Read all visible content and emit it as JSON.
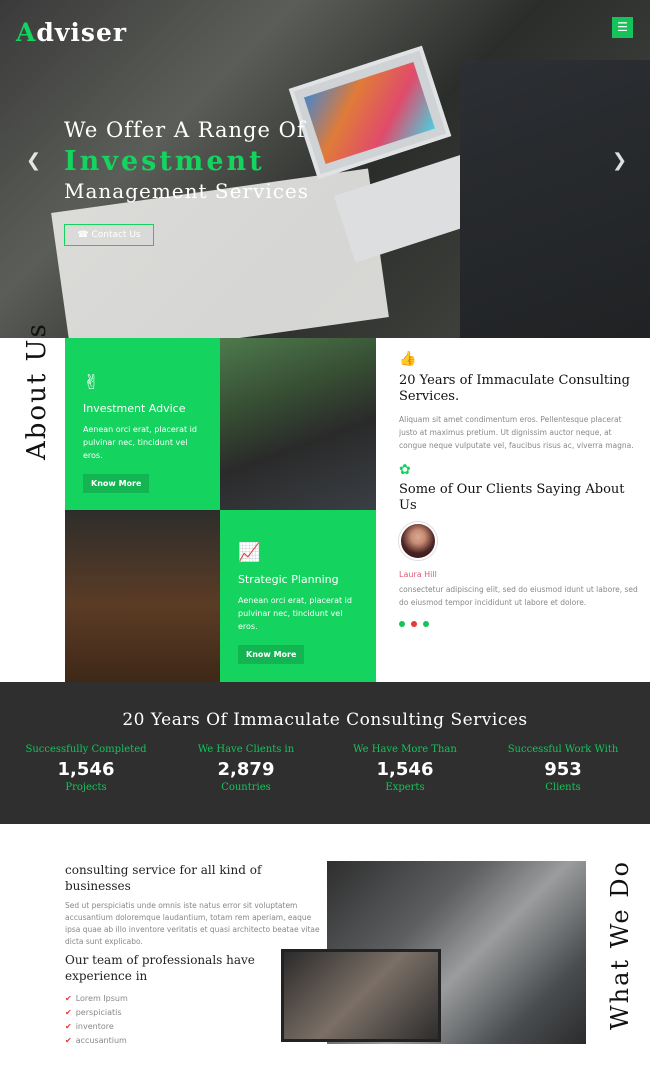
{
  "brand": {
    "logo_first": "A",
    "logo_rest": "dviser",
    "accent": "#14d35e"
  },
  "hero": {
    "line1": "We Offer A Range Of",
    "line2": "Investment",
    "line3": "Management Services",
    "contact_label": "Contact Us",
    "menu_icon": "hamburger-icon",
    "prev_icon": "chevron-left-icon",
    "next_icon": "chevron-right-icon"
  },
  "about": {
    "title": "About Us",
    "tile1": {
      "icon": "victory-hand-icon",
      "title": "Investment Advice",
      "text": "Aenean orci erat, placerat id pulvinar nec, tincidunt vel eros.",
      "button": "Know More"
    },
    "tile2": {
      "icon": "chart-up-icon",
      "title": "Strategic Planning",
      "text": "Aenean orci erat, placerat id pulvinar nec, tincidunt vel eros.",
      "button": "Know More"
    },
    "block1": {
      "icon": "thumbs-up-icon",
      "title": "20 Years of Immaculate Consulting Services.",
      "text": "Aliquam sit amet condimentum eros. Pellentesque placerat justo at maximus pretium. Ut dignissim auctor neque, at congue neque vulputate vel, faucibus risus ac, viverra magna."
    },
    "block2": {
      "icon": "group-icon",
      "title": "Some of Our Clients Saying About Us",
      "name": "Laura Hill",
      "text": "consectetur adipiscing elit, sed do eiusmod idunt ut labore, sed do eiusmod tempor incididunt ut labore et dolore."
    }
  },
  "stats": {
    "title": "20 Years Of Immaculate Consulting Services",
    "items": [
      {
        "label": "Successfully Completed",
        "value": "1,546",
        "sub": "Projects"
      },
      {
        "label": "We Have Clients in",
        "value": "2,879",
        "sub": "Countries"
      },
      {
        "label": "We Have More Than",
        "value": "1,546",
        "sub": "Experts"
      },
      {
        "label": "Successful Work With",
        "value": "953",
        "sub": "Clients"
      }
    ]
  },
  "what": {
    "title": "What We Do",
    "heading1": "consulting service for all kind of businesses",
    "text": "Sed ut perspiciatis unde omnis iste natus error sit voluptatem accusantium doloremque laudantium, totam rem aperiam, eaque ipsa quae ab illo inventore veritatis et quasi architecto beatae vitae dicta sunt explicabo.",
    "heading2": "Our team of professionals have experience in",
    "list": [
      "Lorem Ipsum",
      "perspiciatis",
      "inventore",
      "accusantium"
    ]
  }
}
